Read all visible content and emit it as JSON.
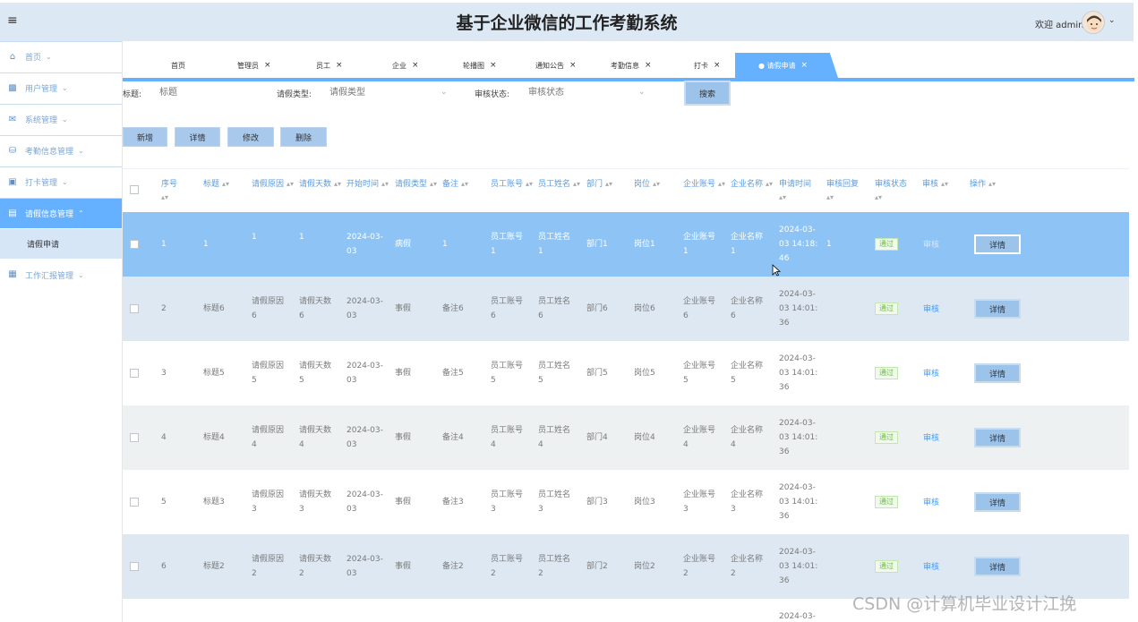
{
  "header": {
    "title": "基于企业微信的工作考勤系统",
    "welcome": "欢迎 admin"
  },
  "sidebar": {
    "items": [
      {
        "label": "首页",
        "icon": "home-icon"
      },
      {
        "label": "用户管理",
        "icon": "user-manage-icon"
      },
      {
        "label": "系统管理",
        "icon": "system-icon"
      },
      {
        "label": "考勤信息管理",
        "icon": "attendance-icon"
      },
      {
        "label": "打卡管理",
        "icon": "clock-in-icon"
      },
      {
        "label": "请假信息管理",
        "icon": "leave-icon",
        "expanded": true
      },
      {
        "label": "工作汇报管理",
        "icon": "report-icon"
      }
    ],
    "subitem": "请假申请"
  },
  "tabs": [
    {
      "label": "首页",
      "closable": false
    },
    {
      "label": "管理员",
      "closable": true
    },
    {
      "label": "员工",
      "closable": true
    },
    {
      "label": "企业",
      "closable": true
    },
    {
      "label": "轮播图",
      "closable": true
    },
    {
      "label": "通知公告",
      "closable": true
    },
    {
      "label": "考勤信息",
      "closable": true
    },
    {
      "label": "打卡",
      "closable": true
    },
    {
      "label": "● 请假申请",
      "closable": true,
      "active": true
    }
  ],
  "search": {
    "title_label": "标题:",
    "title_placeholder": "标题",
    "type_label": "请假类型:",
    "type_placeholder": "请假类型",
    "status_label": "审核状态:",
    "status_placeholder": "审核状态",
    "button": "搜索"
  },
  "actions": {
    "add": "新增",
    "detail": "详情",
    "edit": "修改",
    "delete": "删除"
  },
  "table": {
    "headers": [
      "序号",
      "标题",
      "请假原因",
      "请假天数",
      "开始时间",
      "请假类型",
      "备注",
      "员工账号",
      "员工姓名",
      "部门",
      "岗位",
      "企业账号",
      "企业名称",
      "申请时间",
      "审核回复",
      "审核状态",
      "审核",
      "操作"
    ],
    "rows": [
      {
        "no": "1",
        "title": "1",
        "reason": [
          "1"
        ],
        "days": [
          "1"
        ],
        "start": [
          "2024-03-",
          "03"
        ],
        "type": "病假",
        "remark": "1",
        "emp_acc": [
          "员工账号",
          "1"
        ],
        "emp_name": [
          "员工姓名",
          "1"
        ],
        "dept": "部门1",
        "post": "岗位1",
        "ent_acc": [
          "企业账号",
          "1"
        ],
        "ent_name": [
          "企业名称",
          "1"
        ],
        "apply": [
          "2024-03-",
          "03 14:18:",
          "46"
        ],
        "reply": "1",
        "status": "通过",
        "audit": "审核",
        "op": "详情"
      },
      {
        "no": "2",
        "title": "标题6",
        "reason": [
          "请假原因",
          "6"
        ],
        "days": [
          "请假天数",
          "6"
        ],
        "start": [
          "2024-03-",
          "03"
        ],
        "type": "事假",
        "remark": "备注6",
        "emp_acc": [
          "员工账号",
          "6"
        ],
        "emp_name": [
          "员工姓名",
          "6"
        ],
        "dept": "部门6",
        "post": "岗位6",
        "ent_acc": [
          "企业账号",
          "6"
        ],
        "ent_name": [
          "企业名称",
          "6"
        ],
        "apply": [
          "2024-03-",
          "03 14:01:",
          "36"
        ],
        "reply": "",
        "status": "通过",
        "audit": "审核",
        "op": "详情"
      },
      {
        "no": "3",
        "title": "标题5",
        "reason": [
          "请假原因",
          "5"
        ],
        "days": [
          "请假天数",
          "5"
        ],
        "start": [
          "2024-03-",
          "03"
        ],
        "type": "事假",
        "remark": "备注5",
        "emp_acc": [
          "员工账号",
          "5"
        ],
        "emp_name": [
          "员工姓名",
          "5"
        ],
        "dept": "部门5",
        "post": "岗位5",
        "ent_acc": [
          "企业账号",
          "5"
        ],
        "ent_name": [
          "企业名称",
          "5"
        ],
        "apply": [
          "2024-03-",
          "03 14:01:",
          "36"
        ],
        "reply": "",
        "status": "通过",
        "audit": "审核",
        "op": "详情"
      },
      {
        "no": "4",
        "title": "标题4",
        "reason": [
          "请假原因",
          "4"
        ],
        "days": [
          "请假天数",
          "4"
        ],
        "start": [
          "2024-03-",
          "03"
        ],
        "type": "事假",
        "remark": "备注4",
        "emp_acc": [
          "员工账号",
          "4"
        ],
        "emp_name": [
          "员工姓名",
          "4"
        ],
        "dept": "部门4",
        "post": "岗位4",
        "ent_acc": [
          "企业账号",
          "4"
        ],
        "ent_name": [
          "企业名称",
          "4"
        ],
        "apply": [
          "2024-03-",
          "03 14:01:",
          "36"
        ],
        "reply": "",
        "status": "通过",
        "audit": "审核",
        "op": "详情"
      },
      {
        "no": "5",
        "title": "标题3",
        "reason": [
          "请假原因",
          "3"
        ],
        "days": [
          "请假天数",
          "3"
        ],
        "start": [
          "2024-03-",
          "03"
        ],
        "type": "事假",
        "remark": "备注3",
        "emp_acc": [
          "员工账号",
          "3"
        ],
        "emp_name": [
          "员工姓名",
          "3"
        ],
        "dept": "部门3",
        "post": "岗位3",
        "ent_acc": [
          "企业账号",
          "3"
        ],
        "ent_name": [
          "企业名称",
          "3"
        ],
        "apply": [
          "2024-03-",
          "03 14:01:",
          "36"
        ],
        "reply": "",
        "status": "通过",
        "audit": "审核",
        "op": "详情"
      },
      {
        "no": "6",
        "title": "标题2",
        "reason": [
          "请假原因",
          "2"
        ],
        "days": [
          "请假天数",
          "2"
        ],
        "start": [
          "2024-03-",
          "03"
        ],
        "type": "事假",
        "remark": "备注2",
        "emp_acc": [
          "员工账号",
          "2"
        ],
        "emp_name": [
          "员工姓名",
          "2"
        ],
        "dept": "部门2",
        "post": "岗位2",
        "ent_acc": [
          "企业账号",
          "2"
        ],
        "ent_name": [
          "企业名称",
          "2"
        ],
        "apply": [
          "2024-03-",
          "03 14:01:",
          "36"
        ],
        "reply": "",
        "status": "通过",
        "audit": "审核",
        "op": "详情"
      }
    ],
    "partial_row_apply": "2024-03-"
  },
  "watermark": "CSDN @计算机毕业设计江挽"
}
